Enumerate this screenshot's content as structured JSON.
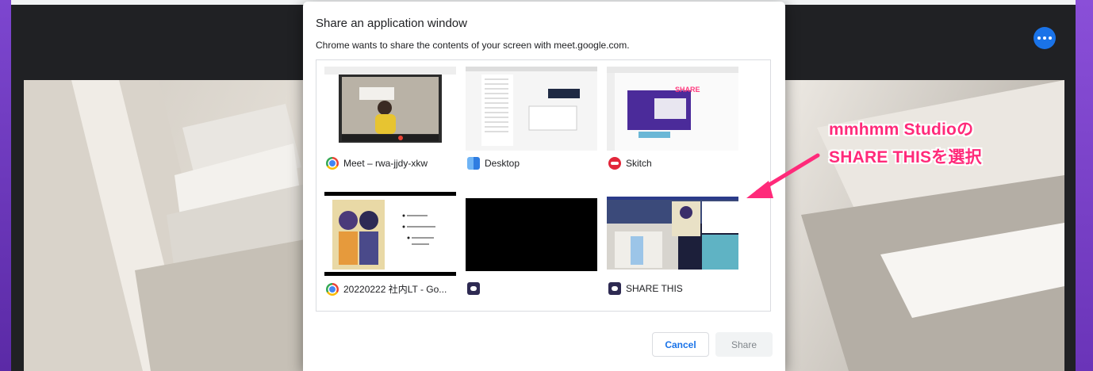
{
  "dialog": {
    "title": "Share an application window",
    "subtitle": "Chrome wants to share the contents of your screen with meet.google.com.",
    "cancel_label": "Cancel",
    "share_label": "Share"
  },
  "sources": [
    {
      "label": "Meet – rwa-jjdy-xkw",
      "icon": "chrome-icon"
    },
    {
      "label": "Desktop",
      "icon": "finder-icon"
    },
    {
      "label": "Skitch",
      "icon": "skitch-icon"
    },
    {
      "label": "20220222 社内LT - Go...",
      "icon": "chrome-icon"
    },
    {
      "label": "",
      "icon": "mmhmm-icon"
    },
    {
      "label": "SHARE THIS",
      "icon": "mmhmm-icon"
    }
  ],
  "annotation": {
    "line1": "mmhmm Studioの",
    "line2": "SHARE THISを選択",
    "color": "#ff2a7a"
  },
  "meet": {
    "more_icon": "more-horizontal-icon",
    "accent": "#1a73e8"
  }
}
